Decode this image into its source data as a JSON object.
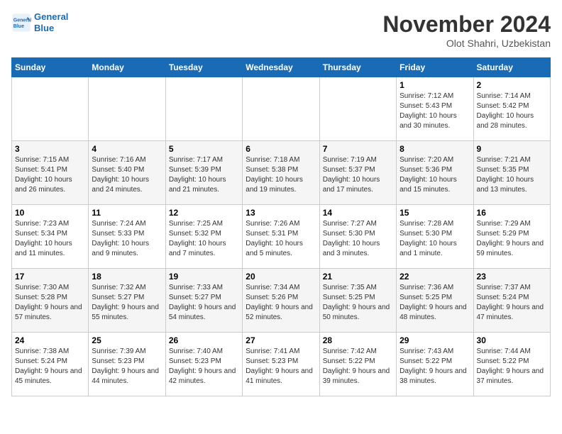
{
  "logo": {
    "line1": "General",
    "line2": "Blue"
  },
  "title": "November 2024",
  "subtitle": "Olot Shahri, Uzbekistan",
  "days_of_week": [
    "Sunday",
    "Monday",
    "Tuesday",
    "Wednesday",
    "Thursday",
    "Friday",
    "Saturday"
  ],
  "weeks": [
    [
      {
        "day": "",
        "info": ""
      },
      {
        "day": "",
        "info": ""
      },
      {
        "day": "",
        "info": ""
      },
      {
        "day": "",
        "info": ""
      },
      {
        "day": "",
        "info": ""
      },
      {
        "day": "1",
        "info": "Sunrise: 7:12 AM\nSunset: 5:43 PM\nDaylight: 10 hours and 30 minutes."
      },
      {
        "day": "2",
        "info": "Sunrise: 7:14 AM\nSunset: 5:42 PM\nDaylight: 10 hours and 28 minutes."
      }
    ],
    [
      {
        "day": "3",
        "info": "Sunrise: 7:15 AM\nSunset: 5:41 PM\nDaylight: 10 hours and 26 minutes."
      },
      {
        "day": "4",
        "info": "Sunrise: 7:16 AM\nSunset: 5:40 PM\nDaylight: 10 hours and 24 minutes."
      },
      {
        "day": "5",
        "info": "Sunrise: 7:17 AM\nSunset: 5:39 PM\nDaylight: 10 hours and 21 minutes."
      },
      {
        "day": "6",
        "info": "Sunrise: 7:18 AM\nSunset: 5:38 PM\nDaylight: 10 hours and 19 minutes."
      },
      {
        "day": "7",
        "info": "Sunrise: 7:19 AM\nSunset: 5:37 PM\nDaylight: 10 hours and 17 minutes."
      },
      {
        "day": "8",
        "info": "Sunrise: 7:20 AM\nSunset: 5:36 PM\nDaylight: 10 hours and 15 minutes."
      },
      {
        "day": "9",
        "info": "Sunrise: 7:21 AM\nSunset: 5:35 PM\nDaylight: 10 hours and 13 minutes."
      }
    ],
    [
      {
        "day": "10",
        "info": "Sunrise: 7:23 AM\nSunset: 5:34 PM\nDaylight: 10 hours and 11 minutes."
      },
      {
        "day": "11",
        "info": "Sunrise: 7:24 AM\nSunset: 5:33 PM\nDaylight: 10 hours and 9 minutes."
      },
      {
        "day": "12",
        "info": "Sunrise: 7:25 AM\nSunset: 5:32 PM\nDaylight: 10 hours and 7 minutes."
      },
      {
        "day": "13",
        "info": "Sunrise: 7:26 AM\nSunset: 5:31 PM\nDaylight: 10 hours and 5 minutes."
      },
      {
        "day": "14",
        "info": "Sunrise: 7:27 AM\nSunset: 5:30 PM\nDaylight: 10 hours and 3 minutes."
      },
      {
        "day": "15",
        "info": "Sunrise: 7:28 AM\nSunset: 5:30 PM\nDaylight: 10 hours and 1 minute."
      },
      {
        "day": "16",
        "info": "Sunrise: 7:29 AM\nSunset: 5:29 PM\nDaylight: 9 hours and 59 minutes."
      }
    ],
    [
      {
        "day": "17",
        "info": "Sunrise: 7:30 AM\nSunset: 5:28 PM\nDaylight: 9 hours and 57 minutes."
      },
      {
        "day": "18",
        "info": "Sunrise: 7:32 AM\nSunset: 5:27 PM\nDaylight: 9 hours and 55 minutes."
      },
      {
        "day": "19",
        "info": "Sunrise: 7:33 AM\nSunset: 5:27 PM\nDaylight: 9 hours and 54 minutes."
      },
      {
        "day": "20",
        "info": "Sunrise: 7:34 AM\nSunset: 5:26 PM\nDaylight: 9 hours and 52 minutes."
      },
      {
        "day": "21",
        "info": "Sunrise: 7:35 AM\nSunset: 5:25 PM\nDaylight: 9 hours and 50 minutes."
      },
      {
        "day": "22",
        "info": "Sunrise: 7:36 AM\nSunset: 5:25 PM\nDaylight: 9 hours and 48 minutes."
      },
      {
        "day": "23",
        "info": "Sunrise: 7:37 AM\nSunset: 5:24 PM\nDaylight: 9 hours and 47 minutes."
      }
    ],
    [
      {
        "day": "24",
        "info": "Sunrise: 7:38 AM\nSunset: 5:24 PM\nDaylight: 9 hours and 45 minutes."
      },
      {
        "day": "25",
        "info": "Sunrise: 7:39 AM\nSunset: 5:23 PM\nDaylight: 9 hours and 44 minutes."
      },
      {
        "day": "26",
        "info": "Sunrise: 7:40 AM\nSunset: 5:23 PM\nDaylight: 9 hours and 42 minutes."
      },
      {
        "day": "27",
        "info": "Sunrise: 7:41 AM\nSunset: 5:23 PM\nDaylight: 9 hours and 41 minutes."
      },
      {
        "day": "28",
        "info": "Sunrise: 7:42 AM\nSunset: 5:22 PM\nDaylight: 9 hours and 39 minutes."
      },
      {
        "day": "29",
        "info": "Sunrise: 7:43 AM\nSunset: 5:22 PM\nDaylight: 9 hours and 38 minutes."
      },
      {
        "day": "30",
        "info": "Sunrise: 7:44 AM\nSunset: 5:22 PM\nDaylight: 9 hours and 37 minutes."
      }
    ]
  ]
}
